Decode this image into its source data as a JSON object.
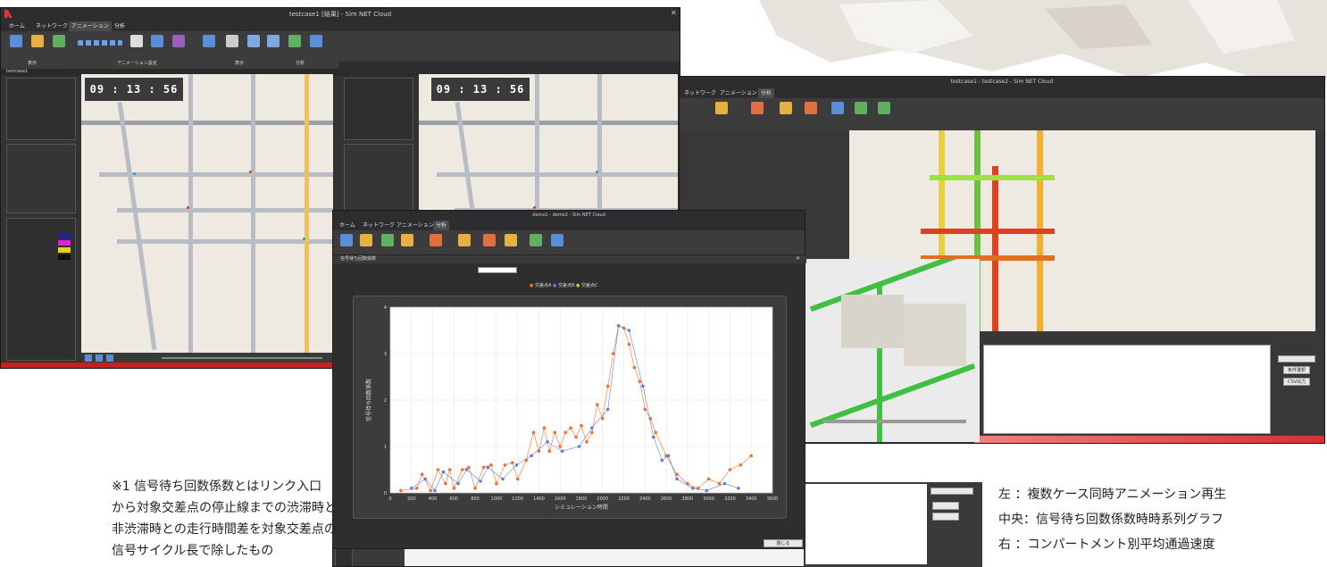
{
  "left_window": {
    "title": "testcase1 [結果] - Sim NET Cloud",
    "tabs": [
      "ホーム",
      "ネットワーク",
      "アニメーション",
      "分析"
    ],
    "active_tab": "アニメーション",
    "ribbon_groups": [
      "表示",
      "アニメーション設定",
      "表示",
      "分析"
    ],
    "sub_title": "testcase1",
    "clock_a": "09 : 13 : 56",
    "clock_b": "09 : 13 : 56"
  },
  "right_window": {
    "title": "testcase1 - testcase2 - Sim NET Cloud",
    "tabs": [
      "ネットワーク",
      "アニメーション",
      "分析"
    ],
    "active_tab": "分析",
    "buttons": [
      "CSV出力",
      "条件選択"
    ]
  },
  "middle_window": {
    "title": "demo1 - demo2 - Sim NET Cloud",
    "tabs": [
      "ホーム",
      "ネットワーク",
      "アニメーション",
      "分析"
    ],
    "active_tab": "分析",
    "dialog_title": "信号待ち回数係数",
    "legend": [
      "交差点A",
      "交差点B",
      "交差点C"
    ],
    "close_button": "閉じる"
  },
  "chart_data": {
    "type": "line",
    "ylabel": "信号待ち回数係数",
    "xlabel": "シミュレーション時間",
    "ylim": [
      0,
      4
    ],
    "xlim": [
      0,
      3600
    ],
    "yticks": [
      "0",
      "1",
      "2",
      "3",
      "4"
    ],
    "xticks": [
      "0",
      "200",
      "400",
      "600",
      "800",
      "1000",
      "1200",
      "1400",
      "1600",
      "1800",
      "2000",
      "2200",
      "2400",
      "2600",
      "2800",
      "3000",
      "3200",
      "3400",
      "3600"
    ],
    "series": [
      {
        "name": "",
        "color": "#f07030",
        "x": [
          100,
          250,
          300,
          380,
          450,
          520,
          560,
          600,
          680,
          740,
          800,
          880,
          950,
          1000,
          1080,
          1150,
          1200,
          1280,
          1350,
          1400,
          1450,
          1500,
          1550,
          1600,
          1650,
          1700,
          1750,
          1800,
          1850,
          1900,
          1950,
          2000,
          2050,
          2100,
          2150,
          2200,
          2250,
          2300,
          2350,
          2400,
          2450,
          2500,
          2600,
          2700,
          2800,
          2900,
          3000,
          3100,
          3200,
          3300,
          3400
        ],
        "y": [
          0.05,
          0.1,
          0.4,
          0.05,
          0.5,
          0.2,
          0.5,
          0.1,
          0.5,
          0.55,
          0.1,
          0.55,
          0.6,
          0.2,
          0.6,
          0.65,
          0.3,
          0.7,
          1.3,
          0.9,
          1.4,
          0.9,
          1.3,
          1.0,
          1.3,
          1.4,
          1.2,
          1.45,
          1.1,
          1.3,
          1.9,
          1.6,
          2.3,
          3.0,
          3.6,
          3.55,
          3.2,
          2.7,
          2.4,
          1.8,
          1.6,
          1.3,
          0.8,
          0.4,
          0.2,
          0.1,
          0.3,
          0.2,
          0.5,
          0.6,
          0.8
        ]
      },
      {
        "name": "",
        "color": "#6080d0",
        "x": [
          200,
          330,
          420,
          500,
          640,
          720,
          850,
          920,
          1060,
          1190,
          1330,
          1480,
          1620,
          1780,
          1900,
          2050,
          2150,
          2250,
          2380,
          2480,
          2560,
          2620,
          2700,
          2850,
          2980,
          3150,
          3280
        ],
        "y": [
          0.1,
          0.3,
          0.05,
          0.45,
          0.2,
          0.5,
          0.25,
          0.55,
          0.3,
          0.6,
          0.8,
          1.1,
          0.9,
          1.0,
          1.4,
          1.8,
          3.6,
          3.5,
          2.3,
          1.2,
          0.7,
          0.8,
          0.3,
          0.1,
          0.05,
          0.2,
          0.1
        ]
      },
      {
        "name": "",
        "color": "#c0d040",
        "x": [],
        "y": []
      }
    ]
  },
  "captions": {
    "note": [
      "※1 信号待ち回数係数とはリンク入口",
      "から対象交差点の停止線までの渋滞時と",
      "非渋滞時との走行時間差を対象交差点の",
      "信号サイクル長で除したもの"
    ],
    "legend": [
      "左 ：複数ケース同時アニメーション再生",
      "中央：信号待ち回数係数時時系列グラフ",
      "右 ：コンパートメント別平均通過速度"
    ]
  },
  "colors": {
    "accent": "#e03030",
    "ribbon": "#3c3c3c",
    "map": "#eeeae2"
  }
}
